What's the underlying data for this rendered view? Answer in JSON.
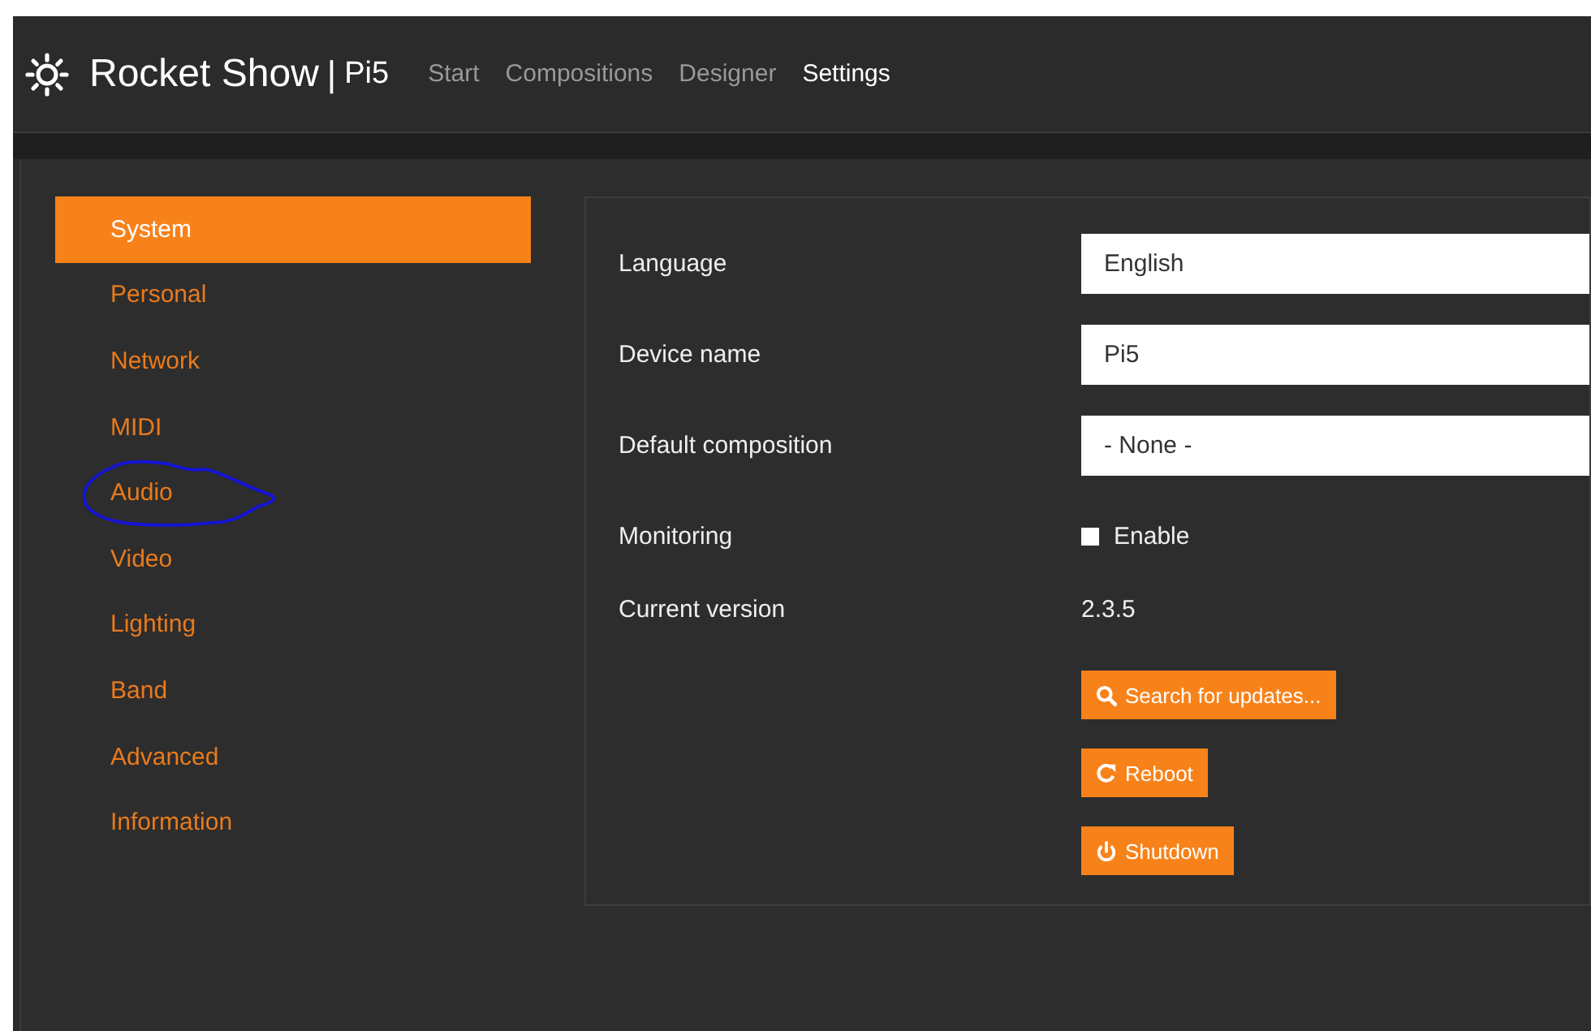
{
  "header": {
    "brand": "Rocket Show",
    "separator": "|",
    "device": "Pi5",
    "nav": [
      {
        "label": "Start",
        "selected": false
      },
      {
        "label": "Compositions",
        "selected": false
      },
      {
        "label": "Designer",
        "selected": false
      },
      {
        "label": "Settings",
        "selected": true
      }
    ]
  },
  "sidebar": {
    "items": [
      {
        "label": "System",
        "selected": true,
        "circled": false
      },
      {
        "label": "Personal",
        "selected": false,
        "circled": false
      },
      {
        "label": "Network",
        "selected": false,
        "circled": false
      },
      {
        "label": "MIDI",
        "selected": false,
        "circled": false
      },
      {
        "label": "Audio",
        "selected": false,
        "circled": true
      },
      {
        "label": "Video",
        "selected": false,
        "circled": false
      },
      {
        "label": "Lighting",
        "selected": false,
        "circled": false
      },
      {
        "label": "Band",
        "selected": false,
        "circled": false
      },
      {
        "label": "Advanced",
        "selected": false,
        "circled": false
      },
      {
        "label": "Information",
        "selected": false,
        "circled": false
      }
    ]
  },
  "settings": {
    "rows": [
      {
        "kind": "select",
        "label": "Language",
        "value": "English"
      },
      {
        "kind": "text",
        "label": "Device name",
        "value": "Pi5"
      },
      {
        "kind": "select",
        "label": "Default composition",
        "value": "- None -"
      },
      {
        "kind": "checkbox",
        "label": "Monitoring",
        "option": "Enable",
        "checked": false
      },
      {
        "kind": "static",
        "label": "Current version",
        "value": "2.3.5"
      }
    ],
    "buttons": [
      {
        "kind": "search",
        "label": "Search for updates..."
      },
      {
        "kind": "reboot",
        "label": "Reboot"
      },
      {
        "kind": "power",
        "label": "Shutdown"
      }
    ]
  }
}
